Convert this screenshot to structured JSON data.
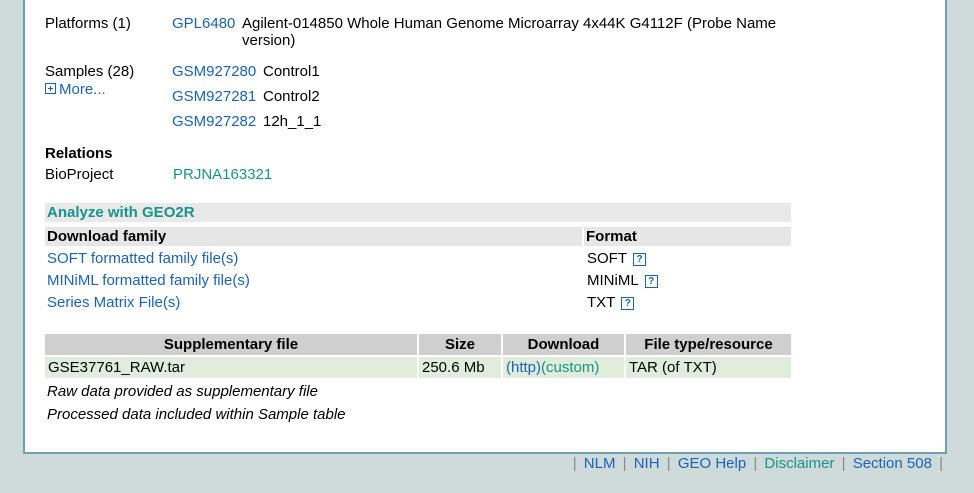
{
  "platforms": {
    "label": "Platforms (1)",
    "id": "GPL6480",
    "description_line1": "Agilent-014850 Whole Human Genome Microarray 4x44K G4112F (Probe Name",
    "description_line2": "version)"
  },
  "samples": {
    "label": "Samples (28)",
    "more": "More...",
    "items": [
      {
        "id": "GSM927280",
        "name": "Control1"
      },
      {
        "id": "GSM927281",
        "name": "Control2"
      },
      {
        "id": "GSM927282",
        "name": "12h_1_1"
      }
    ]
  },
  "relations": {
    "heading": "Relations",
    "bioproject_label": "BioProject",
    "bioproject_id": "PRJNA163321"
  },
  "analyze": {
    "title": "Analyze with GEO2R"
  },
  "download_family": {
    "header_family": "Download family",
    "header_format": "Format",
    "help_glyph": "?",
    "rows": [
      {
        "label": "SOFT formatted family file(s)",
        "format": "SOFT"
      },
      {
        "label": "MINiML formatted family file(s)",
        "format": "MINiML"
      },
      {
        "label": "Series Matrix File(s)",
        "format": "TXT"
      }
    ]
  },
  "supplementary": {
    "headers": {
      "file": "Supplementary file",
      "size": "Size",
      "download": "Download",
      "type": "File type/resource"
    },
    "row": {
      "file": "GSE37761_RAW.tar",
      "size": "250.6 Mb",
      "http": "(http)",
      "custom": "(custom)",
      "type": "TAR (of TXT)"
    },
    "notes": [
      "Raw data provided as supplementary file",
      "Processed data included within Sample table"
    ]
  },
  "footer": {
    "links": [
      "NLM",
      "NIH",
      "GEO Help",
      "Disclaimer",
      "Section 508"
    ]
  },
  "colors": {
    "link": "#1a63b8",
    "teal": "#179487",
    "page_bg": "#cfdbdb",
    "panel_border": "#6f9fb3"
  }
}
